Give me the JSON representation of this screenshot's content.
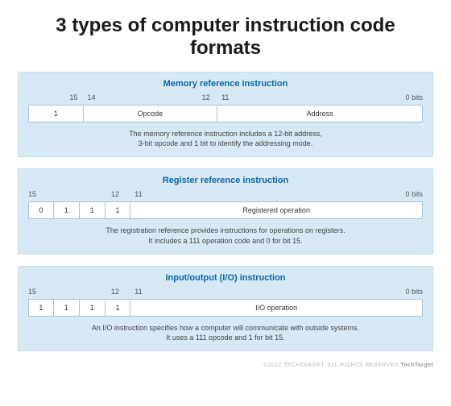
{
  "title": "3 types of computer instruction code formats",
  "cards": [
    {
      "title": "Memory reference instruction",
      "bits": {
        "b15": "15",
        "b14": "14",
        "b12": "12",
        "b11": "11",
        "b0": "0 bits"
      },
      "cells": {
        "c0": "1",
        "c1": "Opcode",
        "c2": "Address"
      },
      "desc_l1": "The memory reference instruction includes a 12-bit address,",
      "desc_l2": "3-bit opcode and 1 bit to identify the addressing mode."
    },
    {
      "title": "Register reference instruction",
      "bits": {
        "b15": "15",
        "b12": "12",
        "b11": "11",
        "b0": "0 bits"
      },
      "cells": {
        "c0": "0",
        "c1": "1",
        "c2": "1",
        "c3": "1",
        "c4": "Registered operation"
      },
      "desc_l1": "The registration reference provides instructions for operations on registers.",
      "desc_l2": "It includes a 111 operation code and 0 for bit 15."
    },
    {
      "title": "Input/output (I/O) instruction",
      "bits": {
        "b15": "15",
        "b12": "12",
        "b11": "11",
        "b0": "0 bits"
      },
      "cells": {
        "c0": "1",
        "c1": "1",
        "c2": "1",
        "c3": "1",
        "c4": "I/O operation"
      },
      "desc_l1": "An I/O instruction specifies how a computer will communicate with outside systems.",
      "desc_l2": "It uses a 111 opcode and 1 for bit 15."
    }
  ],
  "footer": {
    "copyright": "©2022 TECHTARGET. ALL RIGHTS RESERVED",
    "brand": "TechTarget"
  }
}
